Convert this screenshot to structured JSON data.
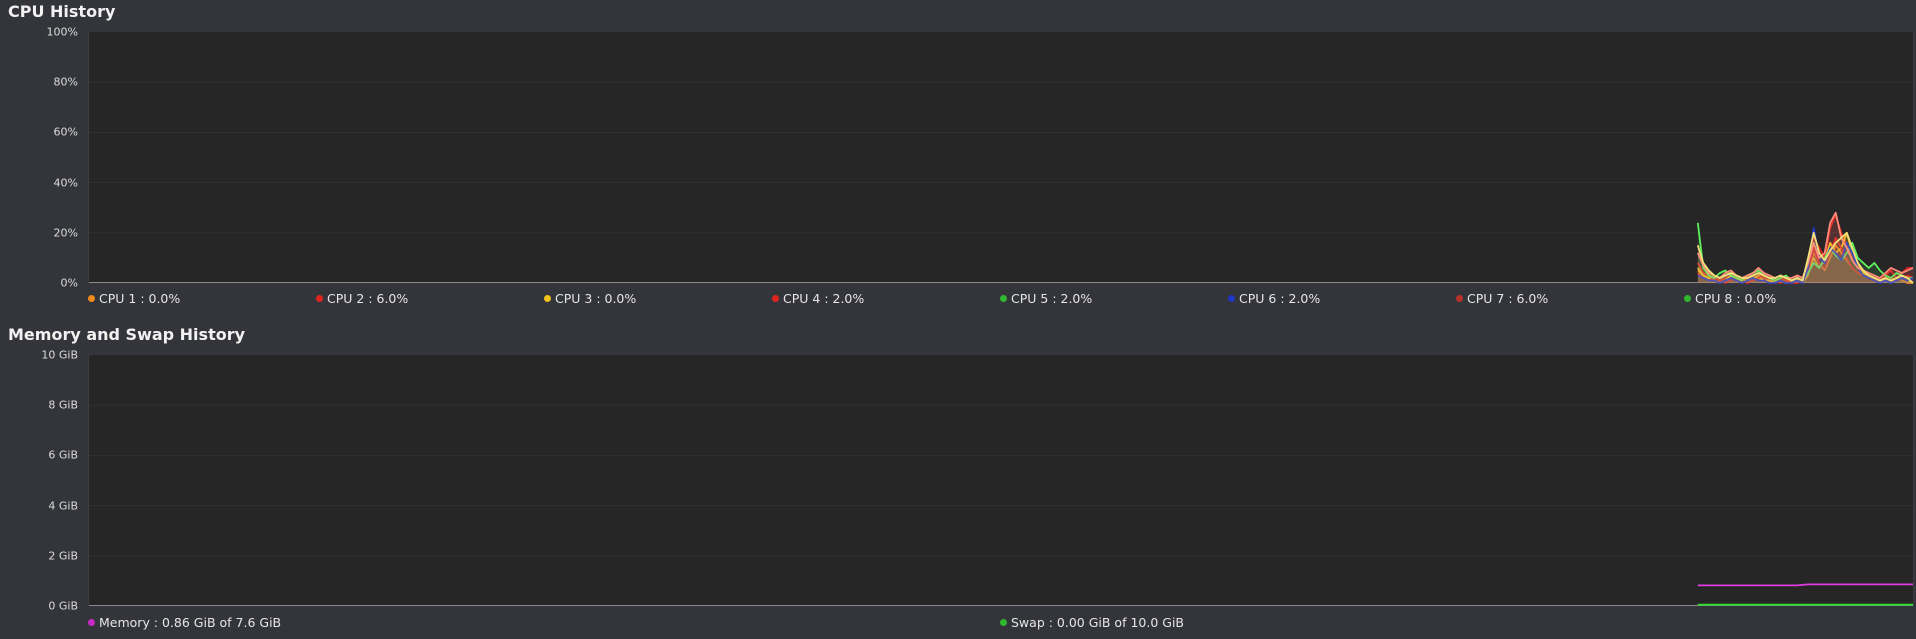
{
  "cpu_section": {
    "title": "CPU History",
    "yticks": [
      "100%",
      "80%",
      "60%",
      "40%",
      "20%",
      "0%"
    ],
    "legend": [
      {
        "label": "CPU 1 : 0.0%",
        "color": "#f28a1c"
      },
      {
        "label": "CPU 2 : 6.0%",
        "color": "#e0231f"
      },
      {
        "label": "CPU 3 : 0.0%",
        "color": "#f2c21c"
      },
      {
        "label": "CPU 4 : 2.0%",
        "color": "#e0231f"
      },
      {
        "label": "CPU 5 : 2.0%",
        "color": "#2fb82f"
      },
      {
        "label": "CPU 6 : 2.0%",
        "color": "#1f36c9"
      },
      {
        "label": "CPU 7 : 6.0%",
        "color": "#b8322a"
      },
      {
        "label": "CPU 8 : 0.0%",
        "color": "#2fb82f"
      }
    ]
  },
  "memory_section": {
    "title": "Memory and Swap History",
    "yticks": [
      "10 GiB",
      "8 GiB",
      "6 GiB",
      "4 GiB",
      "2 GiB",
      "0 GiB"
    ],
    "legend": [
      {
        "label": "Memory : 0.86 GiB of 7.6 GiB",
        "color": "#c82ac8"
      },
      {
        "label": "Swap : 0.00 GiB of 10.0 GiB",
        "color": "#2fb82f"
      }
    ]
  },
  "chart_data": [
    {
      "type": "line",
      "title": "CPU History",
      "ylim": [
        0,
        100
      ],
      "grid": true,
      "legend_position": "bottom",
      "x_history_start_fraction": 0.882,
      "series": [
        {
          "name": "CPU 1",
          "color": "#f28a1c",
          "values": [
            5,
            3,
            2,
            1,
            0,
            1,
            2,
            1,
            0,
            1,
            2,
            3,
            1,
            0,
            0,
            1,
            0,
            0,
            1,
            0,
            3,
            12,
            8,
            5,
            10,
            15,
            12,
            9,
            6,
            4,
            3,
            2,
            1,
            0,
            1,
            0,
            2,
            1,
            0,
            0
          ]
        },
        {
          "name": "CPU 2",
          "color": "#e0231f",
          "values": [
            8,
            4,
            3,
            2,
            1,
            2,
            3,
            2,
            1,
            2,
            3,
            4,
            2,
            1,
            1,
            2,
            1,
            1,
            2,
            1,
            6,
            18,
            14,
            10,
            22,
            27,
            20,
            15,
            10,
            7,
            5,
            3,
            2,
            1,
            3,
            5,
            2,
            4,
            6,
            6
          ]
        },
        {
          "name": "CPU 3",
          "color": "#f2c21c",
          "values": [
            6,
            3,
            2,
            1,
            0,
            1,
            3,
            2,
            1,
            1,
            2,
            2,
            1,
            1,
            0,
            1,
            0,
            0,
            1,
            0,
            4,
            10,
            6,
            9,
            16,
            12,
            14,
            20,
            12,
            8,
            4,
            3,
            2,
            1,
            1,
            0,
            1,
            2,
            1,
            0
          ]
        },
        {
          "name": "CPU 4",
          "color": "#e0231f",
          "values": [
            4,
            2,
            1,
            2,
            1,
            0,
            1,
            2,
            1,
            0,
            1,
            2,
            3,
            2,
            1,
            0,
            1,
            0,
            0,
            1,
            5,
            14,
            8,
            6,
            12,
            18,
            14,
            10,
            6,
            4,
            3,
            2,
            1,
            2,
            3,
            2,
            1,
            2,
            3,
            2
          ]
        },
        {
          "name": "CPU 5",
          "color": "#5cf05c",
          "values": [
            24,
            6,
            3,
            2,
            4,
            5,
            3,
            2,
            1,
            3,
            4,
            5,
            3,
            2,
            1,
            2,
            3,
            1,
            2,
            1,
            4,
            8,
            6,
            10,
            14,
            11,
            9,
            12,
            16,
            10,
            8,
            6,
            8,
            5,
            3,
            2,
            4,
            3,
            2,
            2
          ]
        },
        {
          "name": "CPU 6",
          "color": "#1f36c9",
          "values": [
            3,
            2,
            1,
            1,
            0,
            1,
            2,
            1,
            0,
            1,
            2,
            1,
            1,
            0,
            0,
            1,
            0,
            0,
            1,
            0,
            6,
            22,
            10,
            8,
            14,
            12,
            9,
            16,
            12,
            6,
            3,
            2,
            1,
            0,
            1,
            0,
            1,
            2,
            1,
            2
          ]
        },
        {
          "name": "CPU 7",
          "color": "#ff8a7a",
          "values": [
            12,
            7,
            4,
            3,
            2,
            4,
            5,
            3,
            2,
            3,
            4,
            6,
            4,
            3,
            2,
            3,
            2,
            2,
            3,
            2,
            8,
            16,
            10,
            12,
            24,
            28,
            18,
            14,
            9,
            6,
            5,
            4,
            3,
            2,
            4,
            6,
            5,
            4,
            5,
            6
          ]
        },
        {
          "name": "CPU 8",
          "color": "#f2e07a",
          "values": [
            15,
            8,
            5,
            3,
            2,
            3,
            4,
            3,
            2,
            2,
            3,
            4,
            3,
            2,
            2,
            3,
            2,
            1,
            2,
            1,
            10,
            20,
            12,
            9,
            13,
            16,
            18,
            20,
            14,
            8,
            5,
            3,
            2,
            1,
            2,
            1,
            2,
            3,
            2,
            0
          ]
        }
      ]
    },
    {
      "type": "line",
      "title": "Memory and Swap History",
      "ylim": [
        0,
        10
      ],
      "yunit": "GiB",
      "grid": true,
      "legend_position": "bottom",
      "x_history_start_fraction": 0.882,
      "series": [
        {
          "name": "Memory",
          "color": "#e03ae0",
          "values": [
            0.82,
            0.82,
            0.82,
            0.82,
            0.82,
            0.82,
            0.82,
            0.82,
            0.82,
            0.82,
            0.82,
            0.82,
            0.82,
            0.82,
            0.82,
            0.82,
            0.82,
            0.82,
            0.82,
            0.84,
            0.86,
            0.86,
            0.86,
            0.86,
            0.86,
            0.86,
            0.86,
            0.86,
            0.86,
            0.86,
            0.86,
            0.86,
            0.86,
            0.86,
            0.86,
            0.86,
            0.86,
            0.86,
            0.86,
            0.86
          ]
        },
        {
          "name": "Swap",
          "color": "#2fe02f",
          "values": [
            0.05,
            0.05,
            0.05,
            0.05,
            0.05,
            0.05,
            0.05,
            0.05,
            0.05,
            0.05,
            0.05,
            0.05,
            0.05,
            0.05,
            0.05,
            0.05,
            0.05,
            0.05,
            0.05,
            0.05,
            0.05,
            0.05,
            0.05,
            0.05,
            0.05,
            0.05,
            0.05,
            0.05,
            0.05,
            0.05,
            0.05,
            0.05,
            0.05,
            0.05,
            0.05,
            0.05,
            0.05,
            0.05,
            0.05,
            0.05
          ]
        }
      ]
    }
  ]
}
